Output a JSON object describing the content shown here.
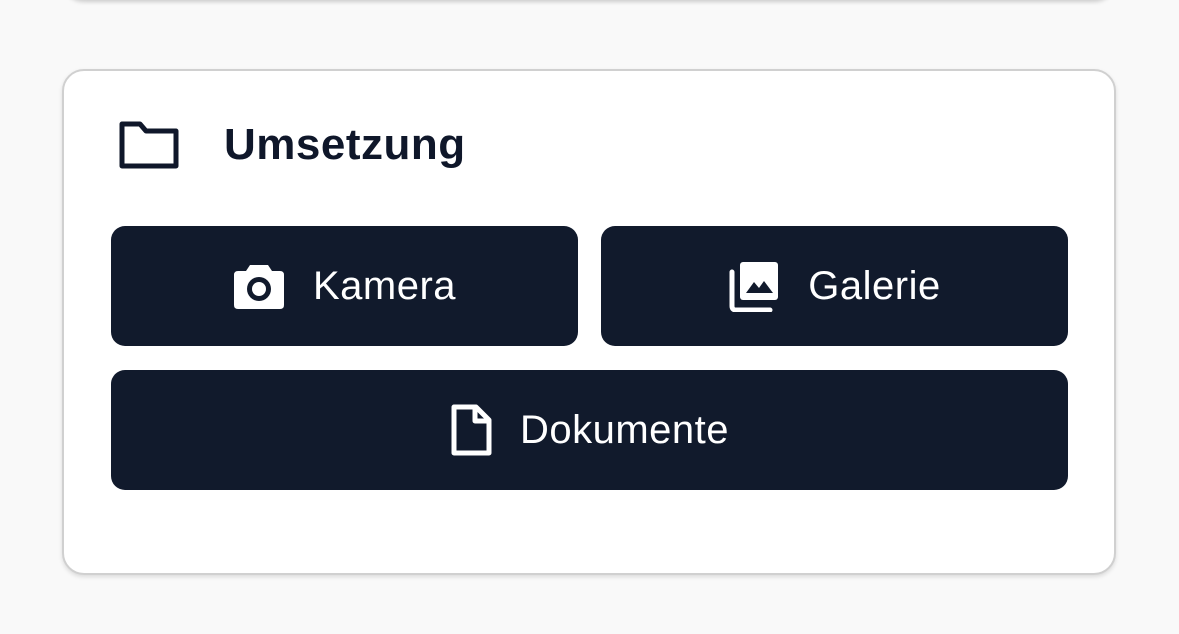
{
  "section": {
    "title": "Umsetzung",
    "header_icon": "folder-icon"
  },
  "buttons": {
    "camera": {
      "label": "Kamera",
      "icon": "camera-icon"
    },
    "gallery": {
      "label": "Galerie",
      "icon": "photo-library-icon"
    },
    "documents": {
      "label": "Dokumente",
      "icon": "document-icon"
    }
  },
  "colors": {
    "button_background": "#111a2c",
    "button_text": "#ffffff",
    "title_text": "#0f172a",
    "card_background": "#ffffff",
    "page_background": "#f9f9f9"
  }
}
